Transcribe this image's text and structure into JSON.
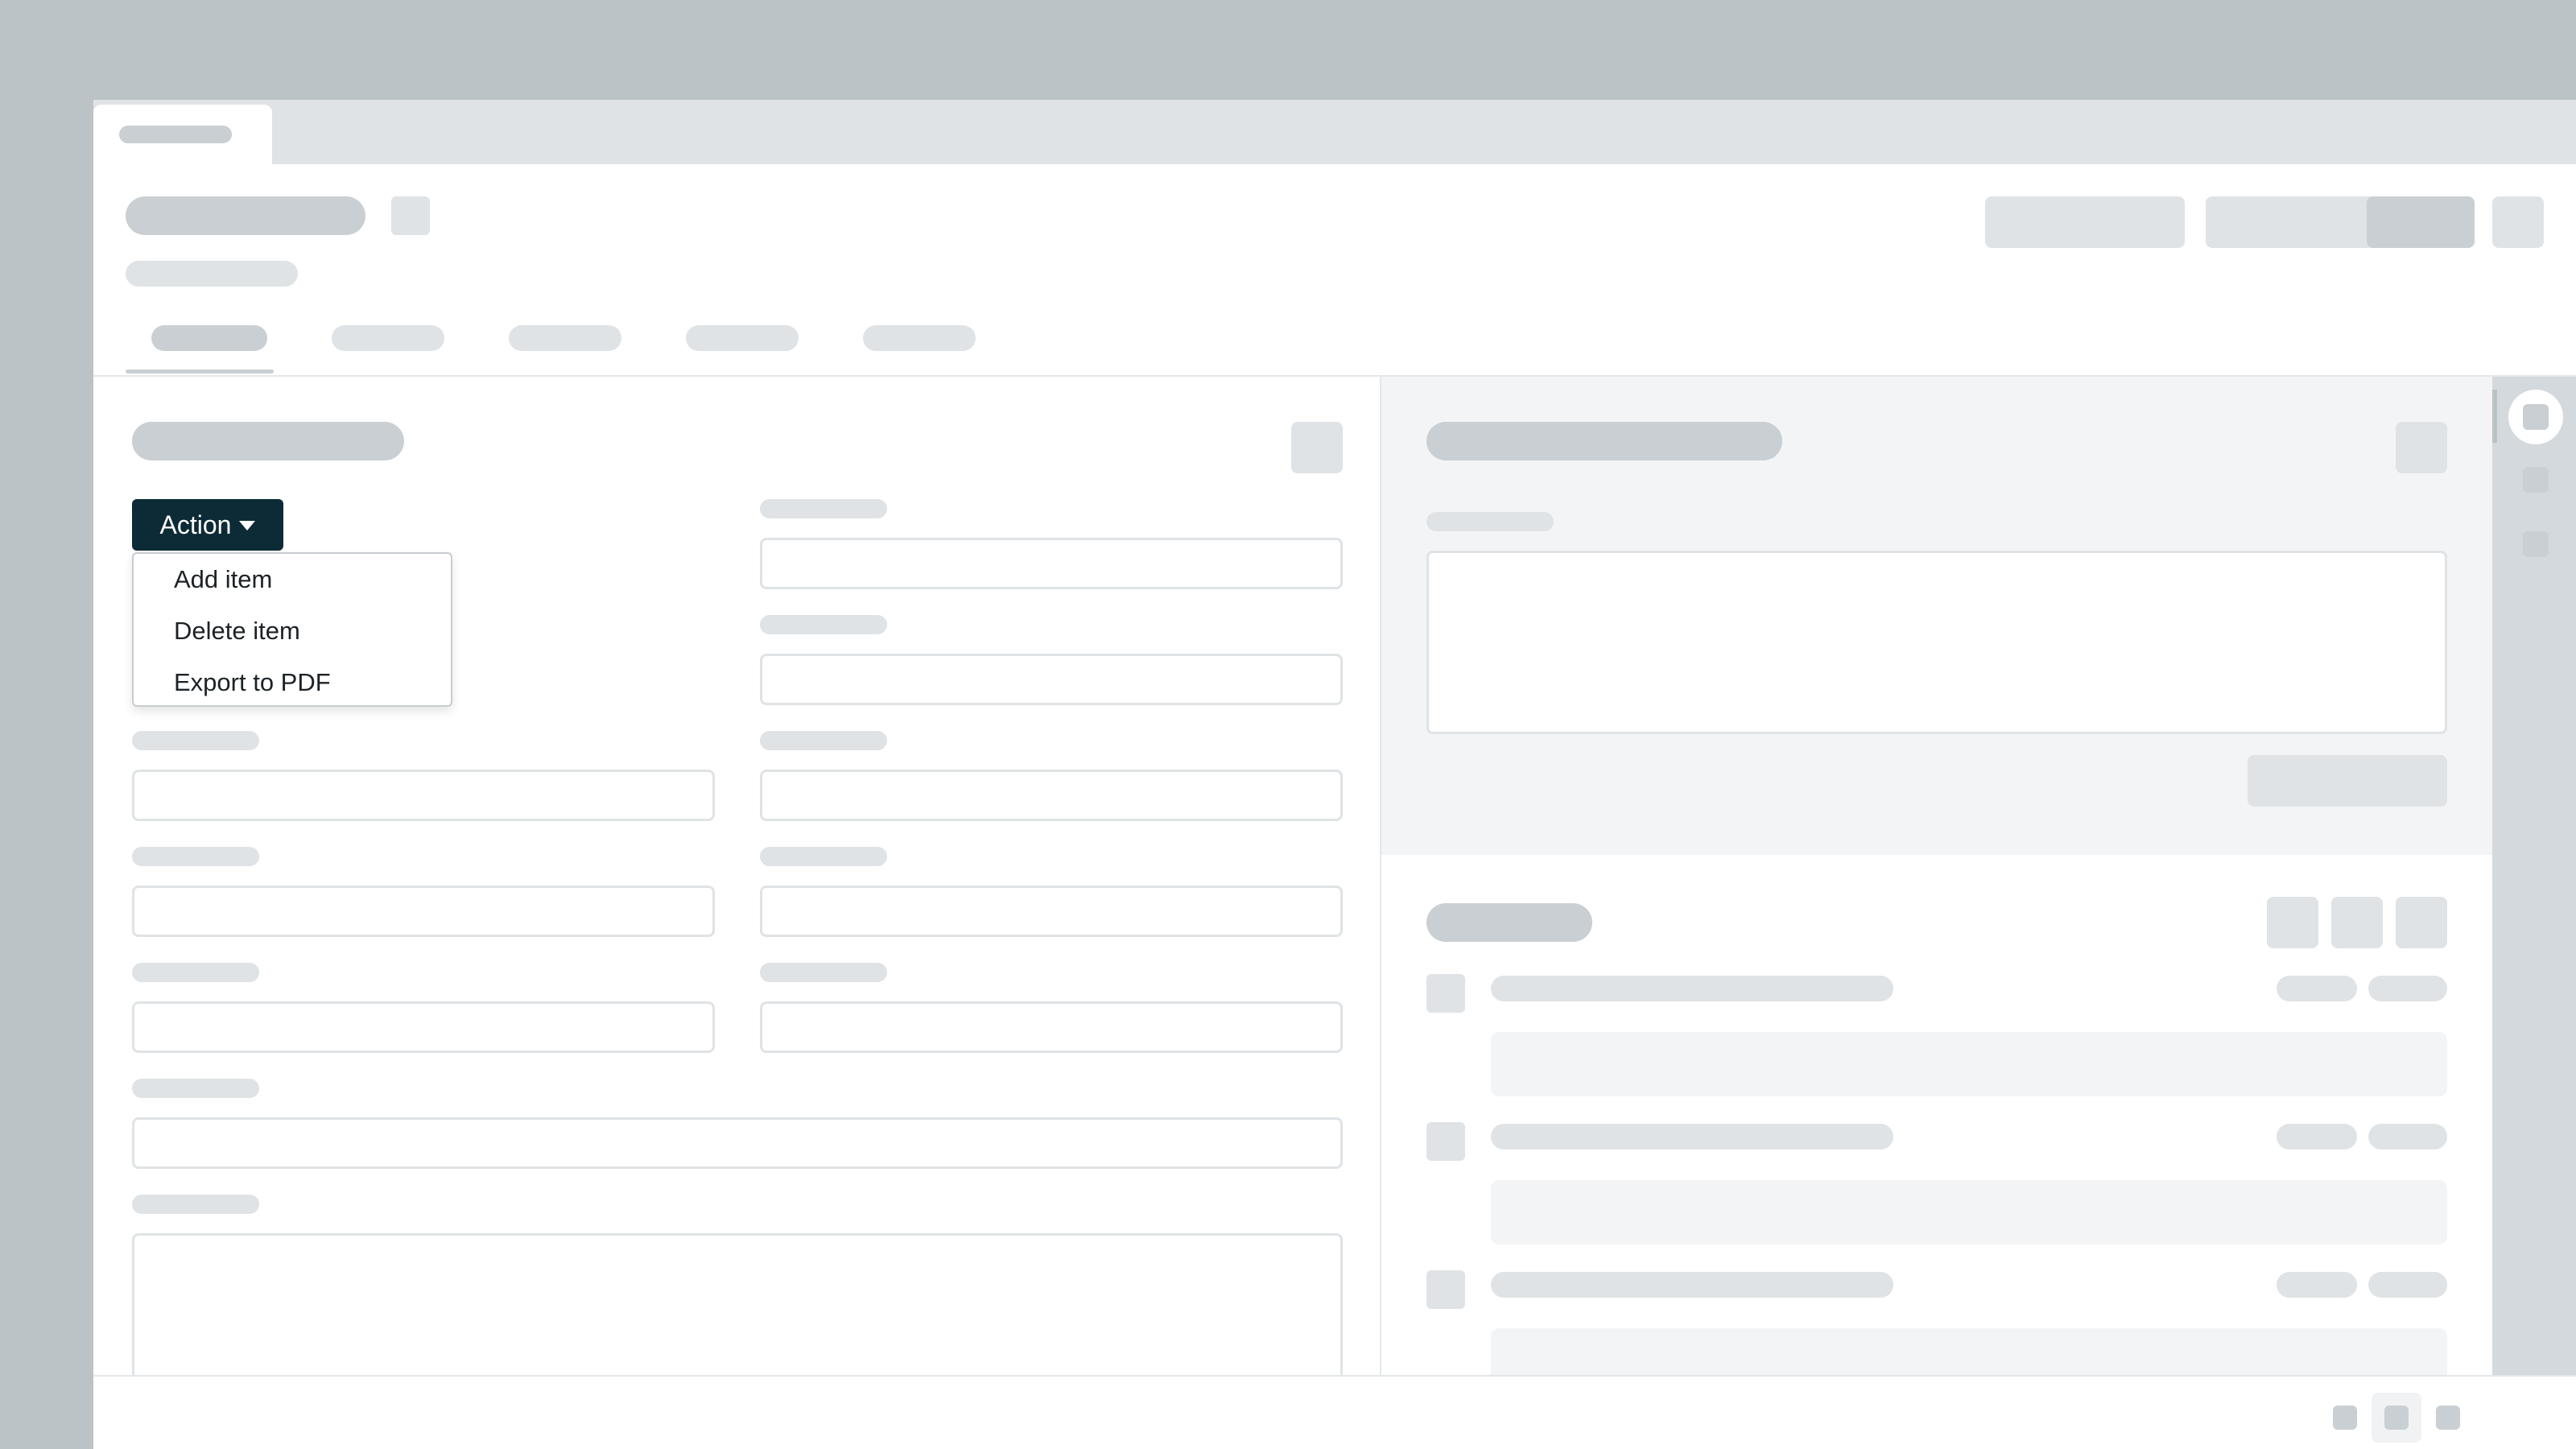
{
  "action_menu": {
    "button_label": "Action",
    "caret_icon": "caret-down-icon",
    "items": [
      {
        "label": "Add item"
      },
      {
        "label": "Delete item"
      },
      {
        "label": "Export to PDF"
      }
    ]
  },
  "colors": {
    "background": "#bcc3c6",
    "skeleton": "#dfe3e5",
    "skeleton_dark": "#c9cfd2",
    "panel_gray": "#f3f4f5",
    "action_button": "#0d2b36"
  }
}
